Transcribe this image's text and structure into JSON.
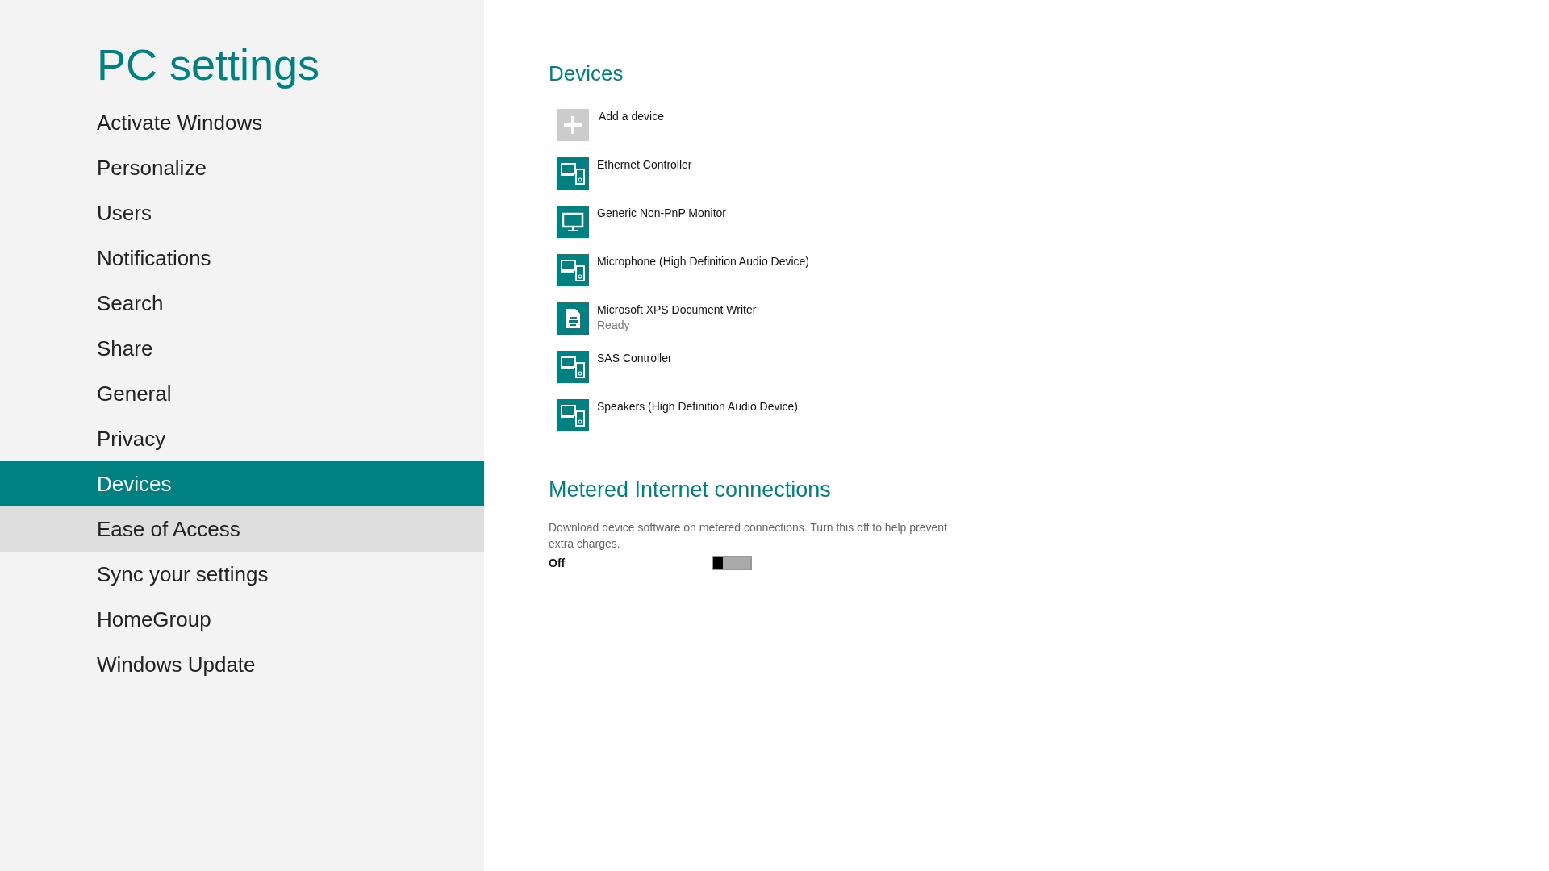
{
  "sidebar": {
    "title": "PC settings",
    "items": [
      {
        "label": "Activate Windows",
        "selected": false,
        "hovered": false
      },
      {
        "label": "Personalize",
        "selected": false,
        "hovered": false
      },
      {
        "label": "Users",
        "selected": false,
        "hovered": false
      },
      {
        "label": "Notifications",
        "selected": false,
        "hovered": false
      },
      {
        "label": "Search",
        "selected": false,
        "hovered": false
      },
      {
        "label": "Share",
        "selected": false,
        "hovered": false
      },
      {
        "label": "General",
        "selected": false,
        "hovered": false
      },
      {
        "label": "Privacy",
        "selected": false,
        "hovered": false
      },
      {
        "label": "Devices",
        "selected": true,
        "hovered": false
      },
      {
        "label": "Ease of Access",
        "selected": false,
        "hovered": true
      },
      {
        "label": "Sync your settings",
        "selected": false,
        "hovered": false
      },
      {
        "label": "HomeGroup",
        "selected": false,
        "hovered": false
      },
      {
        "label": "Windows Update",
        "selected": false,
        "hovered": false
      }
    ]
  },
  "devices": {
    "heading": "Devices",
    "items": [
      {
        "kind": "add",
        "name": "Add a device"
      },
      {
        "kind": "device",
        "name": "Ethernet Controller"
      },
      {
        "kind": "monitor",
        "name": "Generic Non-PnP Monitor"
      },
      {
        "kind": "device",
        "name": "Microphone (High Definition Audio Device)"
      },
      {
        "kind": "printer",
        "name": "Microsoft XPS Document Writer",
        "status": "Ready"
      },
      {
        "kind": "device",
        "name": "SAS Controller"
      },
      {
        "kind": "device",
        "name": "Speakers (High Definition Audio Device)"
      }
    ]
  },
  "metered": {
    "heading": "Metered Internet connections",
    "description": "Download device software on metered connections. Turn this off to help prevent extra charges.",
    "state_label": "Off",
    "on": false
  }
}
